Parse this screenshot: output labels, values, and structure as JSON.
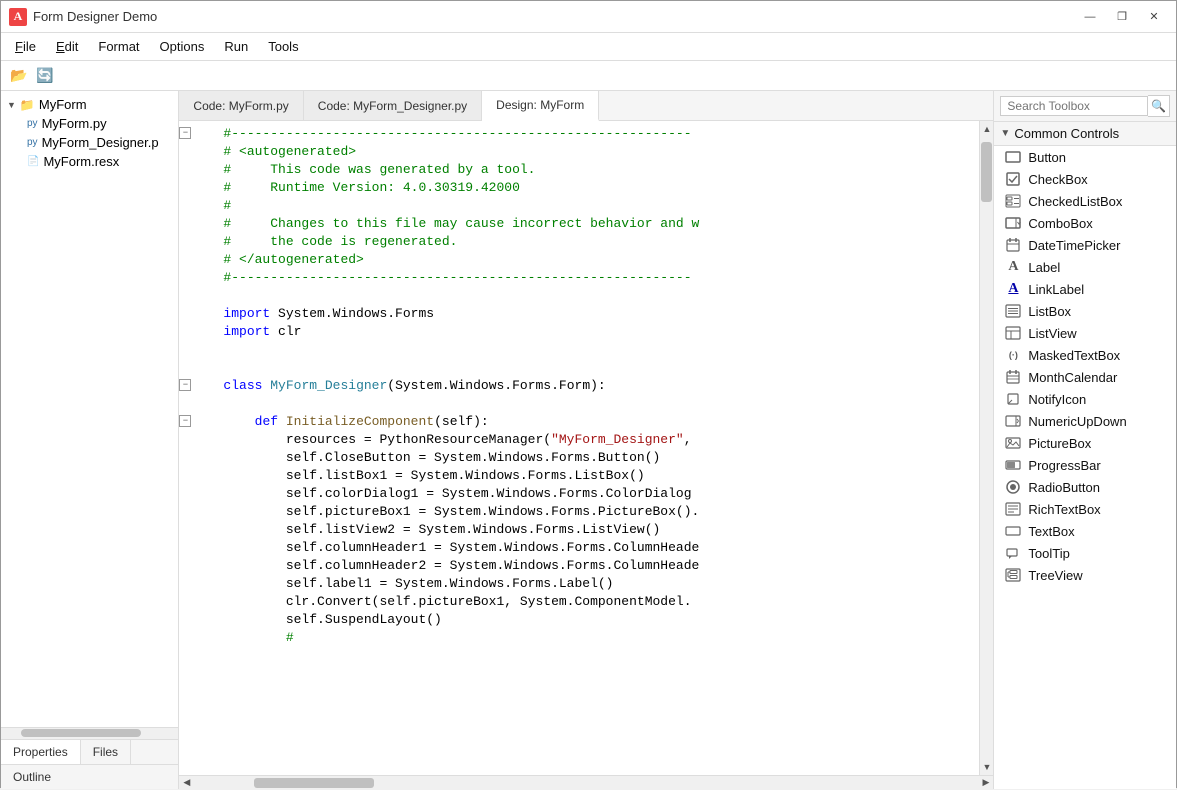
{
  "window": {
    "title": "Form Designer Demo",
    "icon": "A"
  },
  "titlebar": {
    "minimize": "—",
    "maximize": "❐",
    "close": "✕"
  },
  "menu": {
    "items": [
      "File",
      "Edit",
      "Format",
      "Options",
      "Run",
      "Tools"
    ]
  },
  "toolbar": {
    "open_icon": "📂",
    "refresh_icon": "🔄"
  },
  "filetree": {
    "root": "MyForm",
    "children": [
      "MyForm.py",
      "MyForm_Designer.p",
      "MyForm.resx"
    ]
  },
  "left_tabs": {
    "properties": "Properties",
    "files": "Files"
  },
  "outline": "Outline",
  "editor_tabs": [
    {
      "label": "Code: MyForm.py",
      "active": false
    },
    {
      "label": "Code: MyForm_Designer.py",
      "active": false
    },
    {
      "label": "Design: MyForm",
      "active": true
    }
  ],
  "code": {
    "lines": [
      {
        "num": "",
        "text": "#-----------------------------------------------------------",
        "type": "comment",
        "collapse": true
      },
      {
        "num": "",
        "text": "# <autogenerated>",
        "type": "comment"
      },
      {
        "num": "",
        "text": "#     This code was generated by a tool.",
        "type": "comment"
      },
      {
        "num": "",
        "text": "#     Runtime Version: 4.0.30319.42000",
        "type": "comment"
      },
      {
        "num": "",
        "text": "#",
        "type": "comment"
      },
      {
        "num": "",
        "text": "#     Changes to this file may cause incorrect behavior and w",
        "type": "comment"
      },
      {
        "num": "",
        "text": "#     the code is regenerated.",
        "type": "comment"
      },
      {
        "num": "",
        "text": "# </autogenerated>",
        "type": "comment"
      },
      {
        "num": "",
        "text": "#-----------------------------------------------------------",
        "type": "comment"
      },
      {
        "num": "",
        "text": "",
        "type": "normal"
      },
      {
        "num": "",
        "text": "import System.Windows.Forms",
        "type": "mixed_import"
      },
      {
        "num": "",
        "text": "import clr",
        "type": "mixed_import"
      },
      {
        "num": "",
        "text": "",
        "type": "normal"
      },
      {
        "num": "",
        "text": "",
        "type": "normal"
      },
      {
        "num": "",
        "text": "class MyForm_Designer(System.Windows.Forms.Form):",
        "type": "class_line",
        "collapse": true
      },
      {
        "num": "",
        "text": "",
        "type": "normal"
      },
      {
        "num": "",
        "text": "    def InitializeComponent(self):",
        "type": "def_line",
        "collapse": true
      },
      {
        "num": "",
        "text": "        resources = PythonResourceManager(\"MyForm_Designer\",",
        "type": "body"
      },
      {
        "num": "",
        "text": "        self.CloseButton = System.Windows.Forms.Button()",
        "type": "body"
      },
      {
        "num": "",
        "text": "        self.listBox1 = System.Windows.Forms.ListBox()",
        "type": "body"
      },
      {
        "num": "",
        "text": "        self.colorDialog1 = System.Windows.Forms.ColorDialog",
        "type": "body"
      },
      {
        "num": "",
        "text": "        self.pictureBox1 = System.Windows.Forms.PictureBox().",
        "type": "body"
      },
      {
        "num": "",
        "text": "        self.listView2 = System.Windows.Forms.ListView()",
        "type": "body"
      },
      {
        "num": "",
        "text": "        self.columnHeader1 = System.Windows.Forms.ColumnHeade",
        "type": "body"
      },
      {
        "num": "",
        "text": "        self.columnHeader2 = System.Windows.Forms.ColumnHeade",
        "type": "body"
      },
      {
        "num": "",
        "text": "        self.label1 = System.Windows.Forms.Label()",
        "type": "body"
      },
      {
        "num": "",
        "text": "        clr.Convert(self.pictureBox1, System.ComponentModel.",
        "type": "body"
      },
      {
        "num": "",
        "text": "        self.SuspendLayout()",
        "type": "body"
      },
      {
        "num": "",
        "text": "        #",
        "type": "comment_body"
      }
    ]
  },
  "toolbox": {
    "search_placeholder": "Search Toolbox",
    "section_label": "Common Controls",
    "items": [
      {
        "label": "Button",
        "icon": "⬜"
      },
      {
        "label": "CheckBox",
        "icon": "☑"
      },
      {
        "label": "CheckedListBox",
        "icon": "⊟"
      },
      {
        "label": "ComboBox",
        "icon": "▤"
      },
      {
        "label": "DateTimePicker",
        "icon": "📅"
      },
      {
        "label": "Label",
        "icon": "A"
      },
      {
        "label": "LinkLabel",
        "icon": "A"
      },
      {
        "label": "ListBox",
        "icon": "≡"
      },
      {
        "label": "ListView",
        "icon": "⊞"
      },
      {
        "label": "MaskedTextBox",
        "icon": "(.)"
      },
      {
        "label": "MonthCalendar",
        "icon": "📆"
      },
      {
        "label": "NotifyIcon",
        "icon": "◱"
      },
      {
        "label": "NumericUpDown",
        "icon": "⊟"
      },
      {
        "label": "PictureBox",
        "icon": "🖼"
      },
      {
        "label": "ProgressBar",
        "icon": "▬"
      },
      {
        "label": "RadioButton",
        "icon": "◉"
      },
      {
        "label": "RichTextBox",
        "icon": "≡"
      },
      {
        "label": "TextBox",
        "icon": "▭"
      },
      {
        "label": "ToolTip",
        "icon": "◱"
      },
      {
        "label": "TreeView",
        "icon": "⊞"
      }
    ]
  },
  "colors": {
    "comment": "#008000",
    "keyword": "#0000ff",
    "class_name": "#267f99",
    "func_name": "#795e26",
    "string": "#a31515",
    "normal": "#000000",
    "import_keyword": "#0000ff"
  }
}
